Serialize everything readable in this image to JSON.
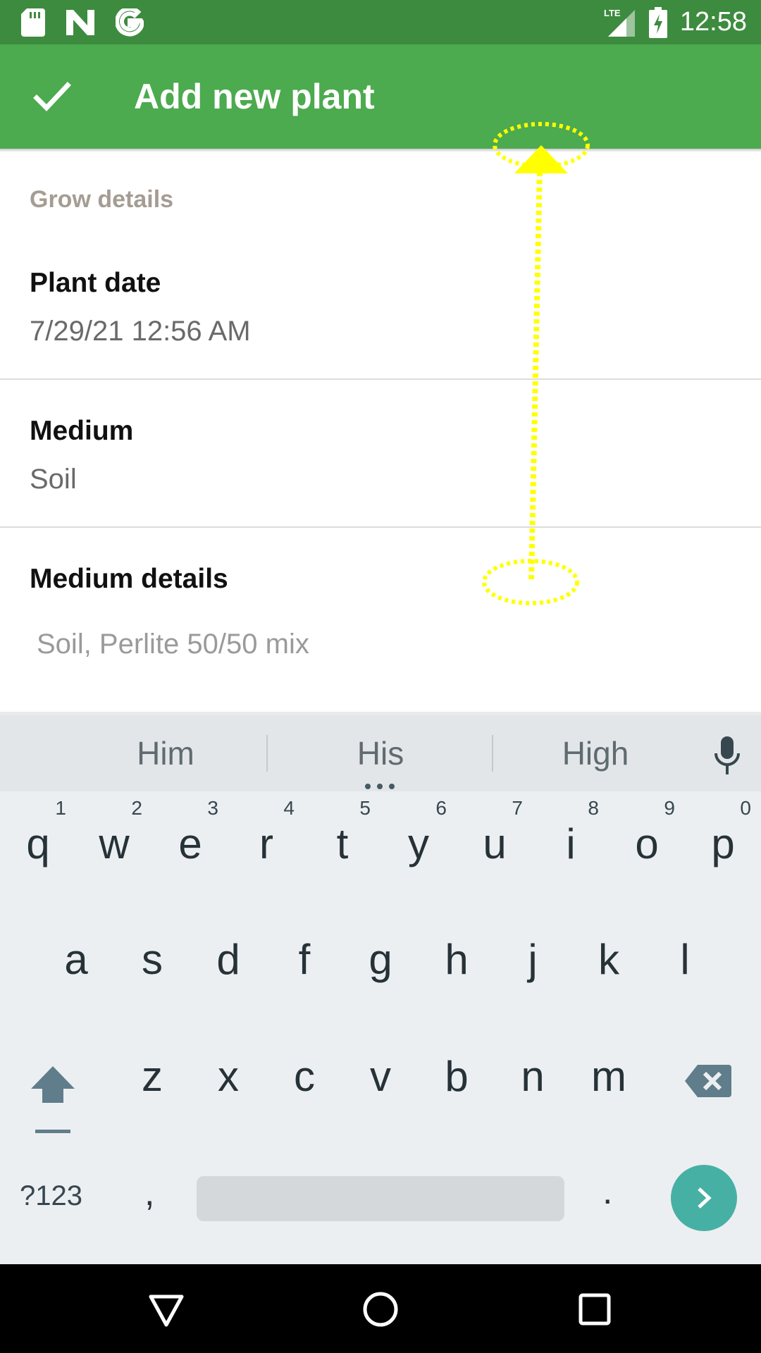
{
  "status_bar": {
    "time": "12:58",
    "network_label": "LTE",
    "icons": [
      "sd-card-icon",
      "n-notification-icon",
      "google-g-icon",
      "lte-signal-icon",
      "battery-charging-icon"
    ]
  },
  "app_bar": {
    "title": "Add new plant",
    "confirm_icon": "check-icon"
  },
  "form": {
    "section_header": "Grow details",
    "plant_date": {
      "label": "Plant date",
      "value": "7/29/21 12:56 AM"
    },
    "medium": {
      "label": "Medium",
      "value": "Soil"
    },
    "medium_details": {
      "label": "Medium details",
      "value": "Soil, Perlite 50/50 mix"
    }
  },
  "keyboard": {
    "suggestions": [
      "Him",
      "His",
      "High"
    ],
    "row1": [
      {
        "k": "q",
        "n": "1"
      },
      {
        "k": "w",
        "n": "2"
      },
      {
        "k": "e",
        "n": "3"
      },
      {
        "k": "r",
        "n": "4"
      },
      {
        "k": "t",
        "n": "5"
      },
      {
        "k": "y",
        "n": "6"
      },
      {
        "k": "u",
        "n": "7"
      },
      {
        "k": "i",
        "n": "8"
      },
      {
        "k": "o",
        "n": "9"
      },
      {
        "k": "p",
        "n": "0"
      }
    ],
    "row2": [
      "a",
      "s",
      "d",
      "f",
      "g",
      "h",
      "j",
      "k",
      "l"
    ],
    "row3": [
      "z",
      "x",
      "c",
      "v",
      "b",
      "n",
      "m"
    ],
    "symbols_label": "?123",
    "comma": ",",
    "period": "."
  },
  "colors": {
    "status_bar": "#3d8b3f",
    "app_bar": "#4caa4f",
    "section_header": "#a59c93",
    "gesture": "#ffff00",
    "enter_key": "#47b0a4"
  }
}
